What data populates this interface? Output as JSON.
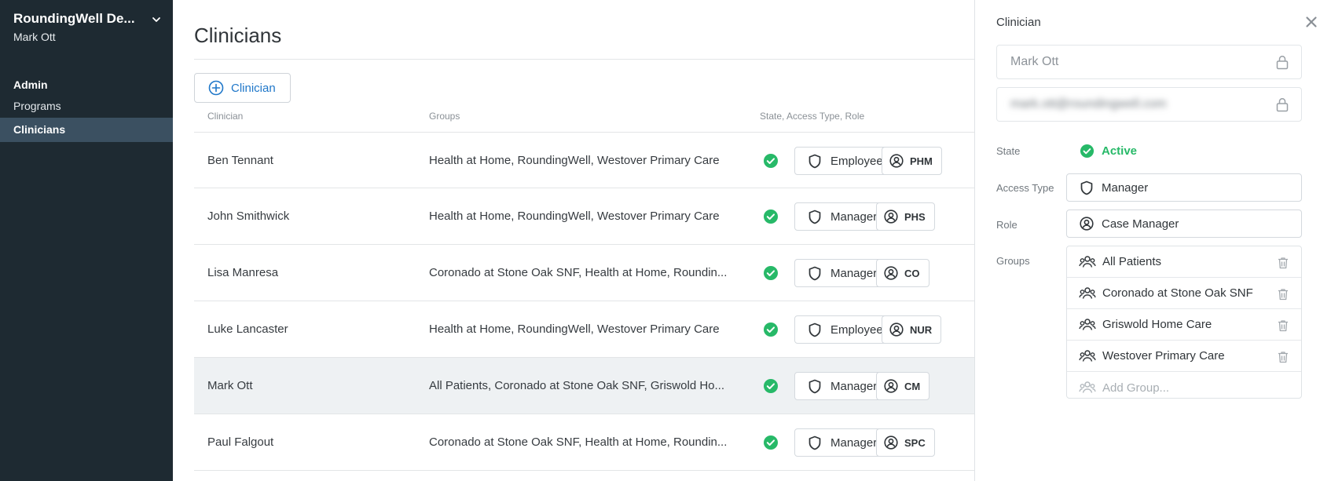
{
  "sidebar": {
    "org_name": "RoundingWell De...",
    "user_name": "Mark Ott",
    "section_heading": "Admin",
    "items": [
      {
        "label": "Programs"
      },
      {
        "label": "Clinicians"
      }
    ]
  },
  "main": {
    "title": "Clinicians",
    "add_button_label": "Clinician",
    "columns": {
      "clinician": "Clinician",
      "groups": "Groups",
      "state": "State, Access Type, Role"
    },
    "rows": [
      {
        "name": "Ben Tennant",
        "groups": "Health at Home, RoundingWell, Westover Primary Care",
        "access": "Employee",
        "role": "PHM"
      },
      {
        "name": "John Smithwick",
        "groups": "Health at Home, RoundingWell, Westover Primary Care",
        "access": "Manager",
        "role": "PHS"
      },
      {
        "name": "Lisa Manresa",
        "groups": "Coronado at Stone Oak SNF, Health at Home, Roundin...",
        "access": "Manager",
        "role": "CO"
      },
      {
        "name": "Luke Lancaster",
        "groups": "Health at Home, RoundingWell, Westover Primary Care",
        "access": "Employee",
        "role": "NUR"
      },
      {
        "name": "Mark Ott",
        "groups": "All Patients, Coronado at Stone Oak SNF, Griswold Ho...",
        "access": "Manager",
        "role": "CM"
      },
      {
        "name": "Paul Falgout",
        "groups": "Coronado at Stone Oak SNF, Health at Home, Roundin...",
        "access": "Manager",
        "role": "SPC"
      }
    ]
  },
  "panel": {
    "title": "Clinician",
    "name_value": "Mark Ott",
    "email_value": "mark.ott@roundingwell.com",
    "state_label": "State",
    "state_value": "Active",
    "access_label": "Access Type",
    "access_value": "Manager",
    "role_label": "Role",
    "role_value": "Case Manager",
    "groups_label": "Groups",
    "groups": [
      "All Patients",
      "Coronado at Stone Oak SNF",
      "Griswold Home Care",
      "Westover Primary Care"
    ],
    "add_group_placeholder": "Add Group..."
  },
  "colors": {
    "sidebar_bg": "#1e2a32",
    "sidebar_active": "#3b5061",
    "accent_blue": "#1f77c9",
    "active_green": "#27b968",
    "selected_row": "#eef1f3"
  },
  "icons": {
    "org_menu": "chevron-down-icon",
    "add": "plus-circle-icon",
    "state": "check-circle-icon",
    "access": "shield-icon",
    "role": "user-circle-icon",
    "close": "close-icon",
    "lock": "lock-icon",
    "group": "users-icon",
    "delete": "trash-icon"
  }
}
